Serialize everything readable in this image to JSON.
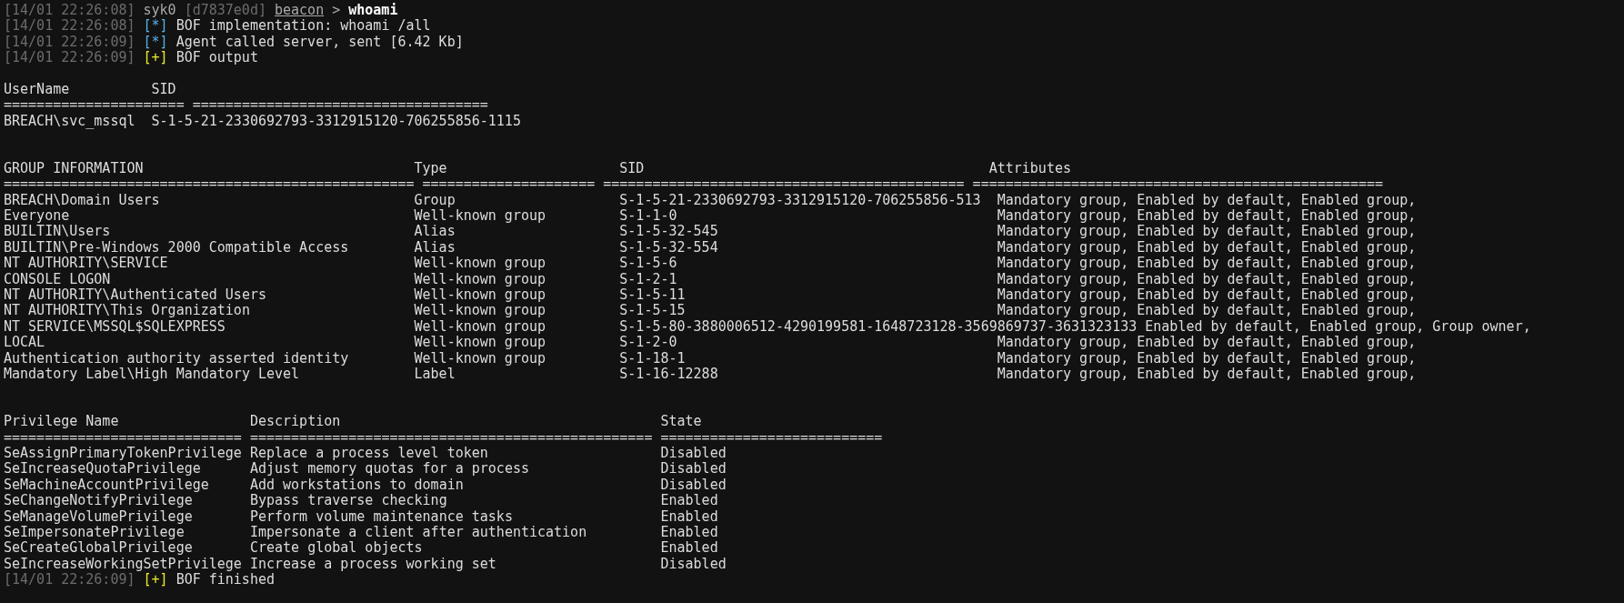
{
  "log": [
    {
      "kind": "prompt",
      "time": "[14/01 22:26:08]",
      "user": "syk0",
      "agent": "[d7837e0d]",
      "context": "beacon",
      "symbol": ">",
      "command": "whoami"
    },
    {
      "kind": "info",
      "time": "[14/01 22:26:08]",
      "marker": "[*]",
      "message": "BOF implementation: whoami /all"
    },
    {
      "kind": "info",
      "time": "[14/01 22:26:09]",
      "marker": "[*]",
      "message": "Agent called server, sent [6.42 Kb]"
    },
    {
      "kind": "success",
      "time": "[14/01 22:26:09]",
      "marker": "[+]",
      "message": "BOF output"
    }
  ],
  "user_table": {
    "columns": [
      "UserName",
      "SID"
    ],
    "rules": [
      "======================",
      "===================================="
    ],
    "rows": [
      [
        "BREACH\\svc_mssql",
        "S-1-5-21-2330692793-3312915120-706255856-1115"
      ]
    ]
  },
  "group_table": {
    "columns": [
      "GROUP INFORMATION",
      "Type",
      "SID",
      "Attributes"
    ],
    "rules": [
      "==================================================",
      "=====================",
      "============================================",
      "=================================================="
    ],
    "rows": [
      [
        "BREACH\\Domain Users",
        "Group",
        "S-1-5-21-2330692793-3312915120-706255856-513",
        "Mandatory group, Enabled by default, Enabled group,"
      ],
      [
        "Everyone",
        "Well-known group",
        "S-1-1-0",
        "Mandatory group, Enabled by default, Enabled group,"
      ],
      [
        "BUILTIN\\Users",
        "Alias",
        "S-1-5-32-545",
        "Mandatory group, Enabled by default, Enabled group,"
      ],
      [
        "BUILTIN\\Pre-Windows 2000 Compatible Access",
        "Alias",
        "S-1-5-32-554",
        "Mandatory group, Enabled by default, Enabled group,"
      ],
      [
        "NT AUTHORITY\\SERVICE",
        "Well-known group",
        "S-1-5-6",
        "Mandatory group, Enabled by default, Enabled group,"
      ],
      [
        "CONSOLE LOGON",
        "Well-known group",
        "S-1-2-1",
        "Mandatory group, Enabled by default, Enabled group,"
      ],
      [
        "NT AUTHORITY\\Authenticated Users",
        "Well-known group",
        "S-1-5-11",
        "Mandatory group, Enabled by default, Enabled group,"
      ],
      [
        "NT AUTHORITY\\This Organization",
        "Well-known group",
        "S-1-5-15",
        "Mandatory group, Enabled by default, Enabled group,"
      ],
      [
        "NT SERVICE\\MSSQL$SQLEXPRESS",
        "Well-known group",
        "S-1-5-80-3880006512-4290199581-1648723128-3569869737-3631323133",
        "Enabled by default, Enabled group, Group owner,"
      ],
      [
        "LOCAL",
        "Well-known group",
        "S-1-2-0",
        "Mandatory group, Enabled by default, Enabled group,"
      ],
      [
        "Authentication authority asserted identity",
        "Well-known group",
        "S-1-18-1",
        "Mandatory group, Enabled by default, Enabled group,"
      ],
      [
        "Mandatory Label\\High Mandatory Level",
        "Label",
        "S-1-16-12288",
        "Mandatory group, Enabled by default, Enabled group,"
      ]
    ]
  },
  "privilege_table": {
    "columns": [
      "Privilege Name",
      "Description",
      "State"
    ],
    "rules": [
      "=============================",
      "=================================================",
      "==========================="
    ],
    "rows": [
      [
        "SeAssignPrimaryTokenPrivilege",
        "Replace a process level token",
        "Disabled"
      ],
      [
        "SeIncreaseQuotaPrivilege",
        "Adjust memory quotas for a process",
        "Disabled"
      ],
      [
        "SeMachineAccountPrivilege",
        "Add workstations to domain",
        "Disabled"
      ],
      [
        "SeChangeNotifyPrivilege",
        "Bypass traverse checking",
        "Enabled"
      ],
      [
        "SeManageVolumePrivilege",
        "Perform volume maintenance tasks",
        "Enabled"
      ],
      [
        "SeImpersonatePrivilege",
        "Impersonate a client after authentication",
        "Enabled"
      ],
      [
        "SeCreateGlobalPrivilege",
        "Create global objects",
        "Enabled"
      ],
      [
        "SeIncreaseWorkingSetPrivilege",
        "Increase a process working set",
        "Disabled"
      ]
    ]
  },
  "footer": {
    "kind": "success",
    "time": "[14/01 22:26:09]",
    "marker": "[+]",
    "message": "BOF finished"
  }
}
